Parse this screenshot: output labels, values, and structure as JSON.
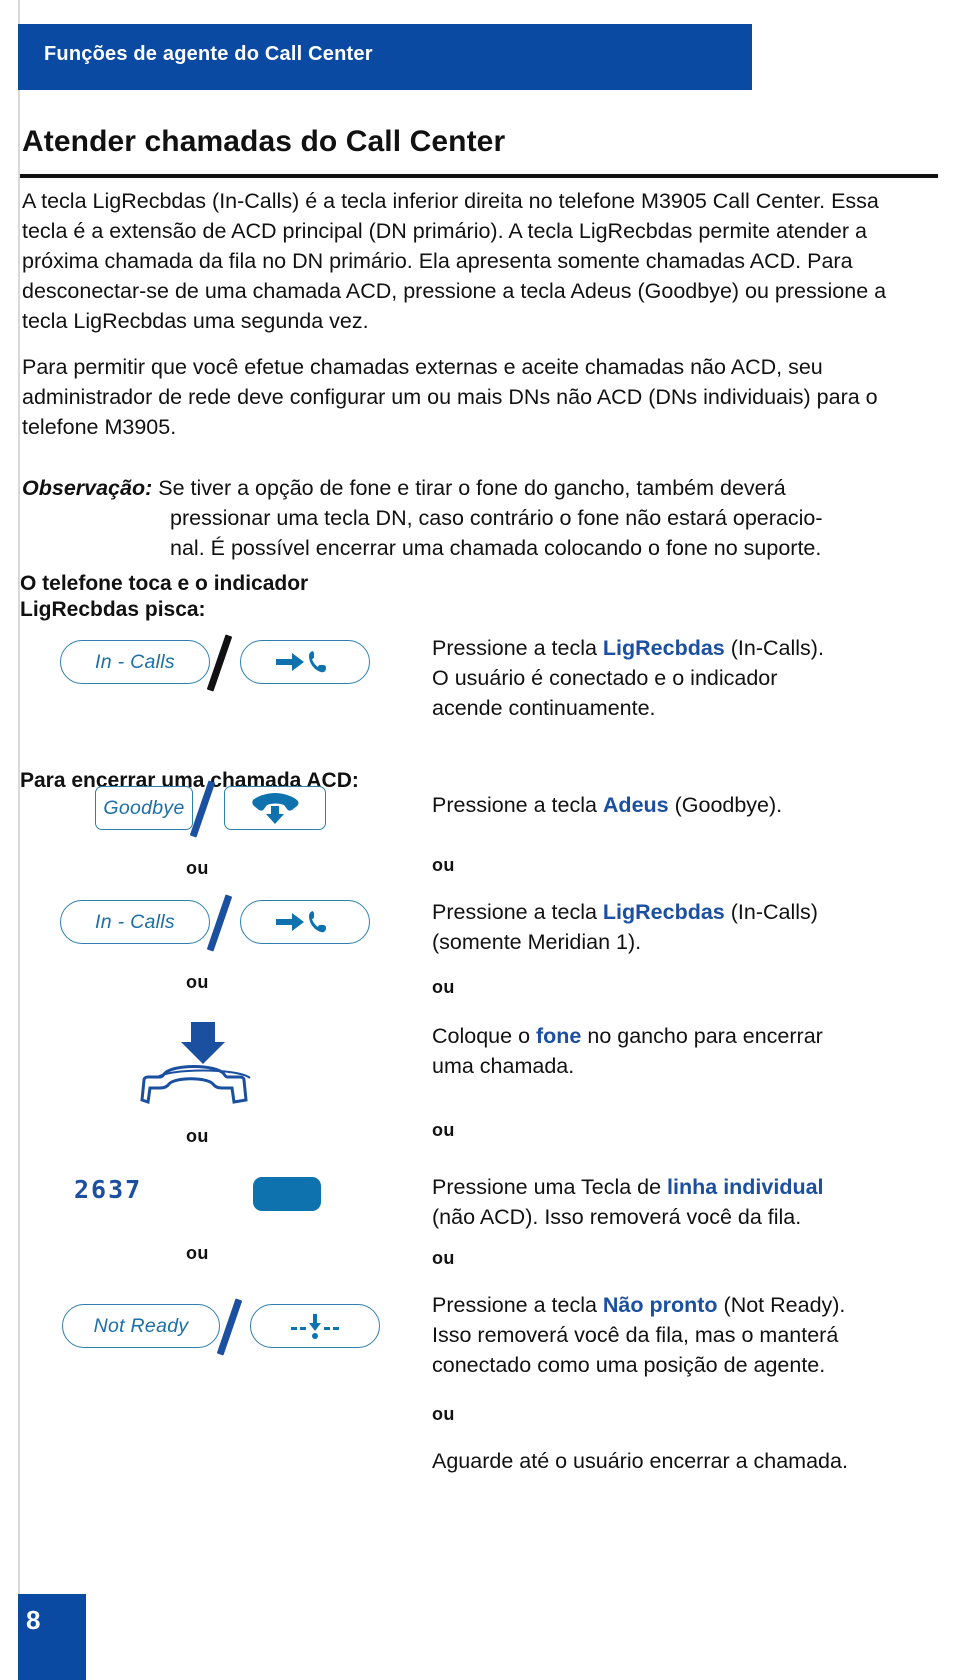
{
  "header": {
    "banner_title": "Funções de agente do Call Center",
    "banner_color": "#0B4AA2"
  },
  "chapter": {
    "title": "Atender chamadas do Call Center"
  },
  "body": {
    "paragraph_1": "A tecla LigRecbdas (In-Calls) é a tecla inferior direita no telefone M3905 Call Center. Essa tecla é a extensão de ACD principal (DN primário). A tecla LigRecbdas permite atender a próxima chamada da fila no DN primário. Ela apresenta somente chamadas ACD. Para desconectar-se de uma chamada ACD, pressione a tecla Adeus (Goodbye) ou pressione a tecla LigRecbdas uma segunda vez.",
    "paragraph_2": "Para permitir que você efetue chamadas externas e aceite chamadas não ACD, seu administrador de rede deve configurar um ou mais DNs não ACD (DNs individuais) para o telefone M3905.",
    "note_label": "Observação:",
    "note_line_1": "Se tiver a opção de fone e tirar o fone do gancho, também deverá",
    "note_line_2": "pressionar uma tecla DN, caso contrário o fone não estará operacio-",
    "note_line_3": "nal. É possível encerrar uma chamada colocando o fone no suporte."
  },
  "subheads": {
    "ringing": "O telefone toca e o indicador\nLigRecbdas pisca:",
    "end_acd_call": "Para encerrar uma chamada ACD:"
  },
  "keys": {
    "in_calls": "In - Calls",
    "goodbye": "Goodbye",
    "not_ready": "Not Ready",
    "lcd_number": "2637"
  },
  "separators": {
    "or": "ou"
  },
  "steps": {
    "step_1_pre": "Pressione a tecla ",
    "step_1_key": "LigRecbdas",
    "step_1_post": " (In-Calls).",
    "step_1_line2": "O usuário é conectado e o indicador",
    "step_1_line3": "acende continuamente.",
    "step_2_pre": "Pressione a tecla ",
    "step_2_key": "Adeus",
    "step_2_post": " (Goodbye).",
    "step_3_pre": "Pressione a tecla ",
    "step_3_key": "LigRecbdas",
    "step_3_post": " (In-Calls)",
    "step_3_line2": "(somente Meridian 1).",
    "step_4_pre": "Coloque o ",
    "step_4_key": "fone",
    "step_4_post": " no gancho para encerrar",
    "step_4_line2": "uma chamada.",
    "step_5_pre": "Pressione uma Tecla de ",
    "step_5_key": "linha individual",
    "step_5_post": "",
    "step_5_line2": "(não ACD). Isso removerá você da fila.",
    "step_6_pre": "Pressione a tecla ",
    "step_6_key": "Não pronto",
    "step_6_post": " (Not Ready).",
    "step_6_line2": "Isso removerá você da fila, mas o manterá",
    "step_6_line3": "conectado como uma posição de agente.",
    "step_7": "Aguarde até o usuário encerrar a chamada."
  },
  "footer": {
    "page_number": "8"
  },
  "colors": {
    "brand_blue": "#0B4AA2",
    "key_outline": "#2E7FAE",
    "key_text": "#1B6FA8",
    "icon_blue": "#0E72AE",
    "accent_blue": "#1B4FA0"
  }
}
